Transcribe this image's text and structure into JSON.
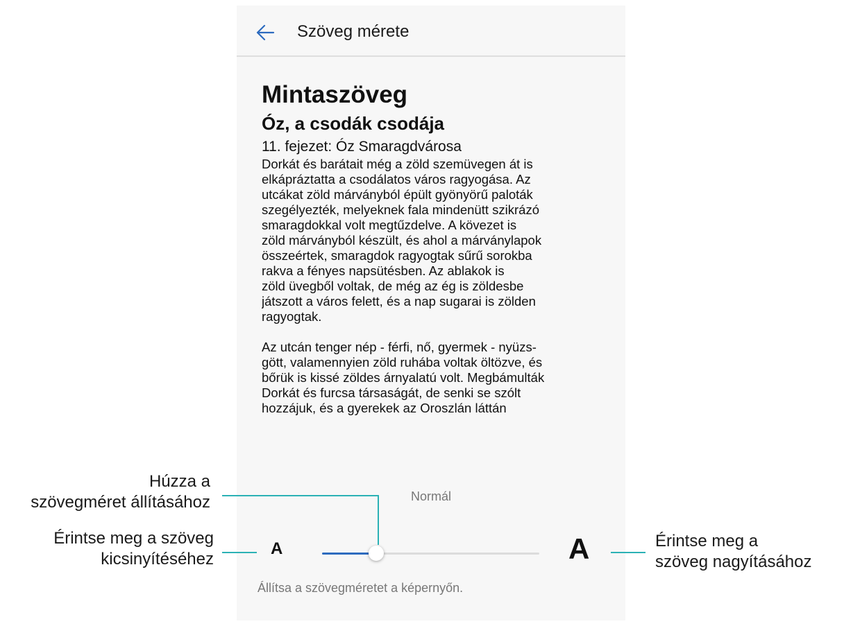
{
  "appbar": {
    "title": "Szöveg mérete",
    "back_icon": "arrow-left-icon",
    "accent_color": "#2d6bbf"
  },
  "preview": {
    "heading": "Mintaszöveg",
    "book_title": "Óz, a csodák csodája",
    "chapter": "11. fejezet: Óz Smaragdvárosa",
    "paragraph1": "Dorkát és barátait még a zöld szemüvegen át is\nelkápráztatta a csodálatos város ragyogása. Az\nutcákat zöld márványból épült gyönyörű paloták\nszegélyezték, melyeknek fala mindenütt szikrázó\nsmaragdokkal volt megtűzdelve. A kövezet is\nzöld márványból készült, és ahol a márványlapok\nösszeértek, smaragdok ragyogtak sűrű sorokba\nrakva a fényes napsütésben. Az ablakok is\nzöld üvegből voltak, de még az ég is zöldesbe\njátszott a város felett, és a nap sugarai is zölden\nragyogtak.",
    "paragraph2": "Az utcán tenger nép - férfi, nő, gyermek - nyüzs-\ngött, valamennyien zöld ruhába voltak öltözve, és\nbőrük is kissé zöldes árnyalatú volt. Megbámulták\nDorkát és furcsa társaságát, de senki se szólt\nhozzájuk, és a gyerekek az Oroszlán láttán"
  },
  "text_size": {
    "label": "Normál",
    "small_button": "A",
    "large_button": "A",
    "slider_level": 0.25,
    "hint": "Állítsa a szövegméretet a képernyőn."
  },
  "callouts": {
    "drag": "Húzza a\nszövegméret állításához",
    "shrink": "Érintse meg a szöveg\nkicsinyítéséhez",
    "enlarge": "Érintse meg a\nszöveg nagyításához",
    "line_color": "#2bb1b5"
  }
}
